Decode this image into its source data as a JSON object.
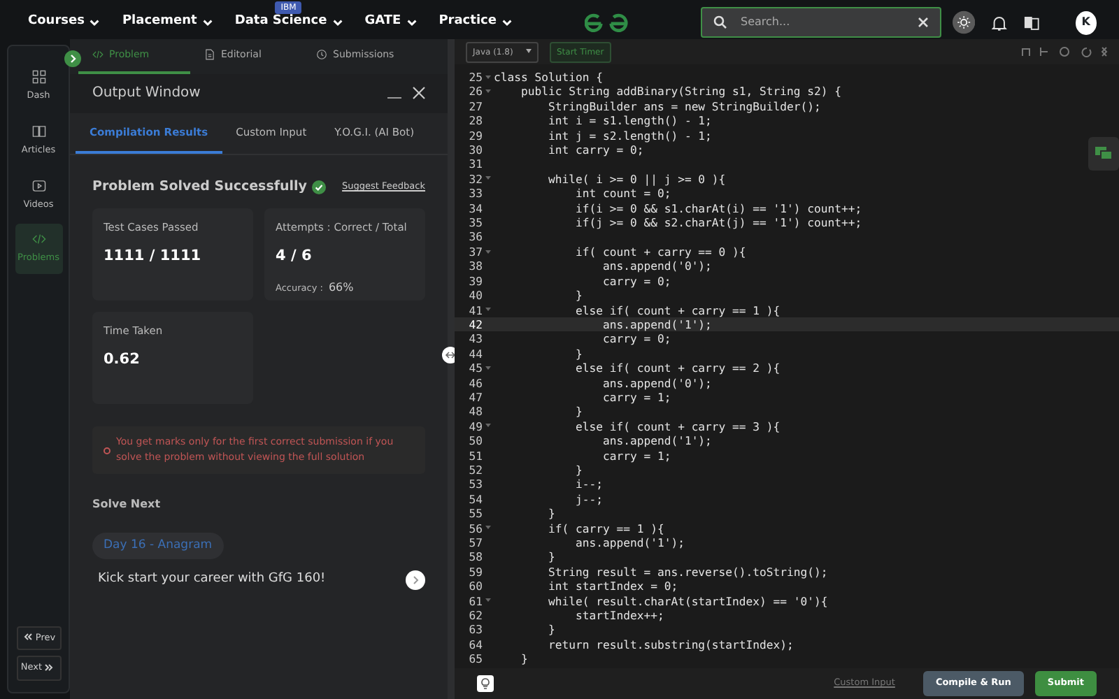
{
  "nav": {
    "items": [
      {
        "label": "Courses"
      },
      {
        "label": "Placement"
      },
      {
        "label": "Data Science",
        "badge": "IBM"
      },
      {
        "label": "GATE"
      },
      {
        "label": "Practice"
      }
    ],
    "search": {
      "placeholder": "Search..."
    },
    "avatar": "K"
  },
  "sidebar": {
    "items": [
      {
        "label": "Dash",
        "selected": false
      },
      {
        "label": "Articles",
        "selected": false
      },
      {
        "label": "Videos",
        "selected": false
      },
      {
        "label": "Problems",
        "selected": true
      }
    ],
    "prev": "Prev",
    "next": "Next"
  },
  "problem_tabs": [
    {
      "label": "Problem",
      "selected": true
    },
    {
      "label": "Editorial",
      "selected": false
    },
    {
      "label": "Submissions",
      "selected": false
    }
  ],
  "output_window": {
    "title": "Output Window",
    "tabs": [
      {
        "label": "Compilation Results",
        "selected": true
      },
      {
        "label": "Custom Input",
        "selected": false
      },
      {
        "label": "Y.O.G.I. (AI Bot)",
        "selected": false
      }
    ],
    "status": "Problem Solved Successfully",
    "feedback_link": "Suggest Feedback",
    "cards": [
      {
        "label": "Test Cases Passed",
        "value": "1111 / 1111"
      },
      {
        "label": "Attempts : Correct / Total",
        "value": "4 / 6",
        "extra_label": "Accuracy :",
        "extra_value": "66%"
      },
      {
        "label": "Time Taken",
        "value": "0.62"
      }
    ],
    "notice": "You get marks only for the first correct submission if you solve the problem without viewing the full solution",
    "solve_next": {
      "heading": "Solve Next",
      "chip": "Day 16 - Anagram",
      "promo": "Kick start your career with GfG 160!"
    }
  },
  "editor": {
    "language": "Java (1.8)",
    "timer": "Start Timer",
    "lines": [
      {
        "n": "25",
        "code": "class Solution {",
        "fold": true,
        "selected": false
      },
      {
        "n": "26",
        "code": "    public String addBinary(String s1, String s2) {",
        "fold": true,
        "selected": false
      },
      {
        "n": "27",
        "code": "        StringBuilder ans = new StringBuilder();",
        "fold": false,
        "selected": false
      },
      {
        "n": "28",
        "code": "        int i = s1.length() - 1;",
        "fold": false,
        "selected": false
      },
      {
        "n": "29",
        "code": "        int j = s2.length() - 1;",
        "fold": false,
        "selected": false
      },
      {
        "n": "30",
        "code": "        int carry = 0;",
        "fold": false,
        "selected": false
      },
      {
        "n": "31",
        "fold": false,
        "selected": false
      },
      {
        "n": "32",
        "code": "        while( i >= 0 || j >= 0 ){",
        "fold": true,
        "selected": false
      },
      {
        "n": "33",
        "code": "            int count = 0;",
        "fold": false,
        "selected": false
      },
      {
        "n": "34",
        "code": "            if(i >= 0 && s1.charAt(i) == '1') count++;",
        "fold": false,
        "selected": false
      },
      {
        "n": "35",
        "code": "            if(j >= 0 && s2.charAt(j) == '1') count++;",
        "fold": false,
        "selected": false
      },
      {
        "n": "36",
        "fold": false,
        "selected": false
      },
      {
        "n": "37",
        "code": "            if( count + carry == 0 ){",
        "fold": true,
        "selected": false
      },
      {
        "n": "38",
        "code": "                ans.append('0');",
        "fold": false,
        "selected": false
      },
      {
        "n": "39",
        "code": "                carry = 0;",
        "fold": false,
        "selected": false
      },
      {
        "n": "40",
        "code": "            }",
        "fold": false,
        "selected": false
      },
      {
        "n": "41",
        "code": "            else if( count + carry == 1 ){",
        "fold": true,
        "selected": false
      },
      {
        "n": "42",
        "code": "                ans.append('1');",
        "fold": false,
        "selected": true
      },
      {
        "n": "43",
        "code": "                carry = 0;",
        "fold": false,
        "selected": false
      },
      {
        "n": "44",
        "code": "            }",
        "fold": false,
        "selected": false
      },
      {
        "n": "45",
        "code": "            else if( count + carry == 2 ){",
        "fold": true,
        "selected": false
      },
      {
        "n": "46",
        "code": "                ans.append('0');",
        "fold": false,
        "selected": false
      },
      {
        "n": "47",
        "code": "                carry = 1;",
        "fold": false,
        "selected": false
      },
      {
        "n": "48",
        "code": "            }",
        "fold": false,
        "selected": false
      },
      {
        "n": "49",
        "code": "            else if( count + carry == 3 ){",
        "fold": true,
        "selected": false
      },
      {
        "n": "50",
        "code": "                ans.append('1');",
        "fold": false,
        "selected": false
      },
      {
        "n": "51",
        "code": "                carry = 1;",
        "fold": false,
        "selected": false
      },
      {
        "n": "52",
        "code": "            }",
        "fold": false,
        "selected": false
      },
      {
        "n": "53",
        "code": "            i--;",
        "fold": false,
        "selected": false
      },
      {
        "n": "54",
        "code": "            j--;",
        "fold": false,
        "selected": false
      },
      {
        "n": "55",
        "code": "        }",
        "fold": false,
        "selected": false
      },
      {
        "n": "56",
        "code": "        if( carry == 1 ){",
        "fold": true,
        "selected": false
      },
      {
        "n": "57",
        "code": "            ans.append('1');",
        "fold": false,
        "selected": false
      },
      {
        "n": "58",
        "code": "        }",
        "fold": false,
        "selected": false
      },
      {
        "n": "59",
        "code": "        String result = ans.reverse().toString();",
        "fold": false,
        "selected": false
      },
      {
        "n": "60",
        "code": "        int startIndex = 0;",
        "fold": false,
        "selected": false
      },
      {
        "n": "61",
        "code": "        while( result.charAt(startIndex) == '0'){",
        "fold": true,
        "selected": false
      },
      {
        "n": "62",
        "code": "            startIndex++;",
        "fold": false,
        "selected": false
      },
      {
        "n": "63",
        "code": "        }",
        "fold": false,
        "selected": false
      },
      {
        "n": "64",
        "code": "        return result.substring(startIndex);",
        "fold": false,
        "selected": false
      },
      {
        "n": "65",
        "code": "    }",
        "fold": false,
        "selected": false
      }
    ],
    "custom_input": "Custom Input",
    "compile": "Compile & Run",
    "submit": "Submit"
  }
}
